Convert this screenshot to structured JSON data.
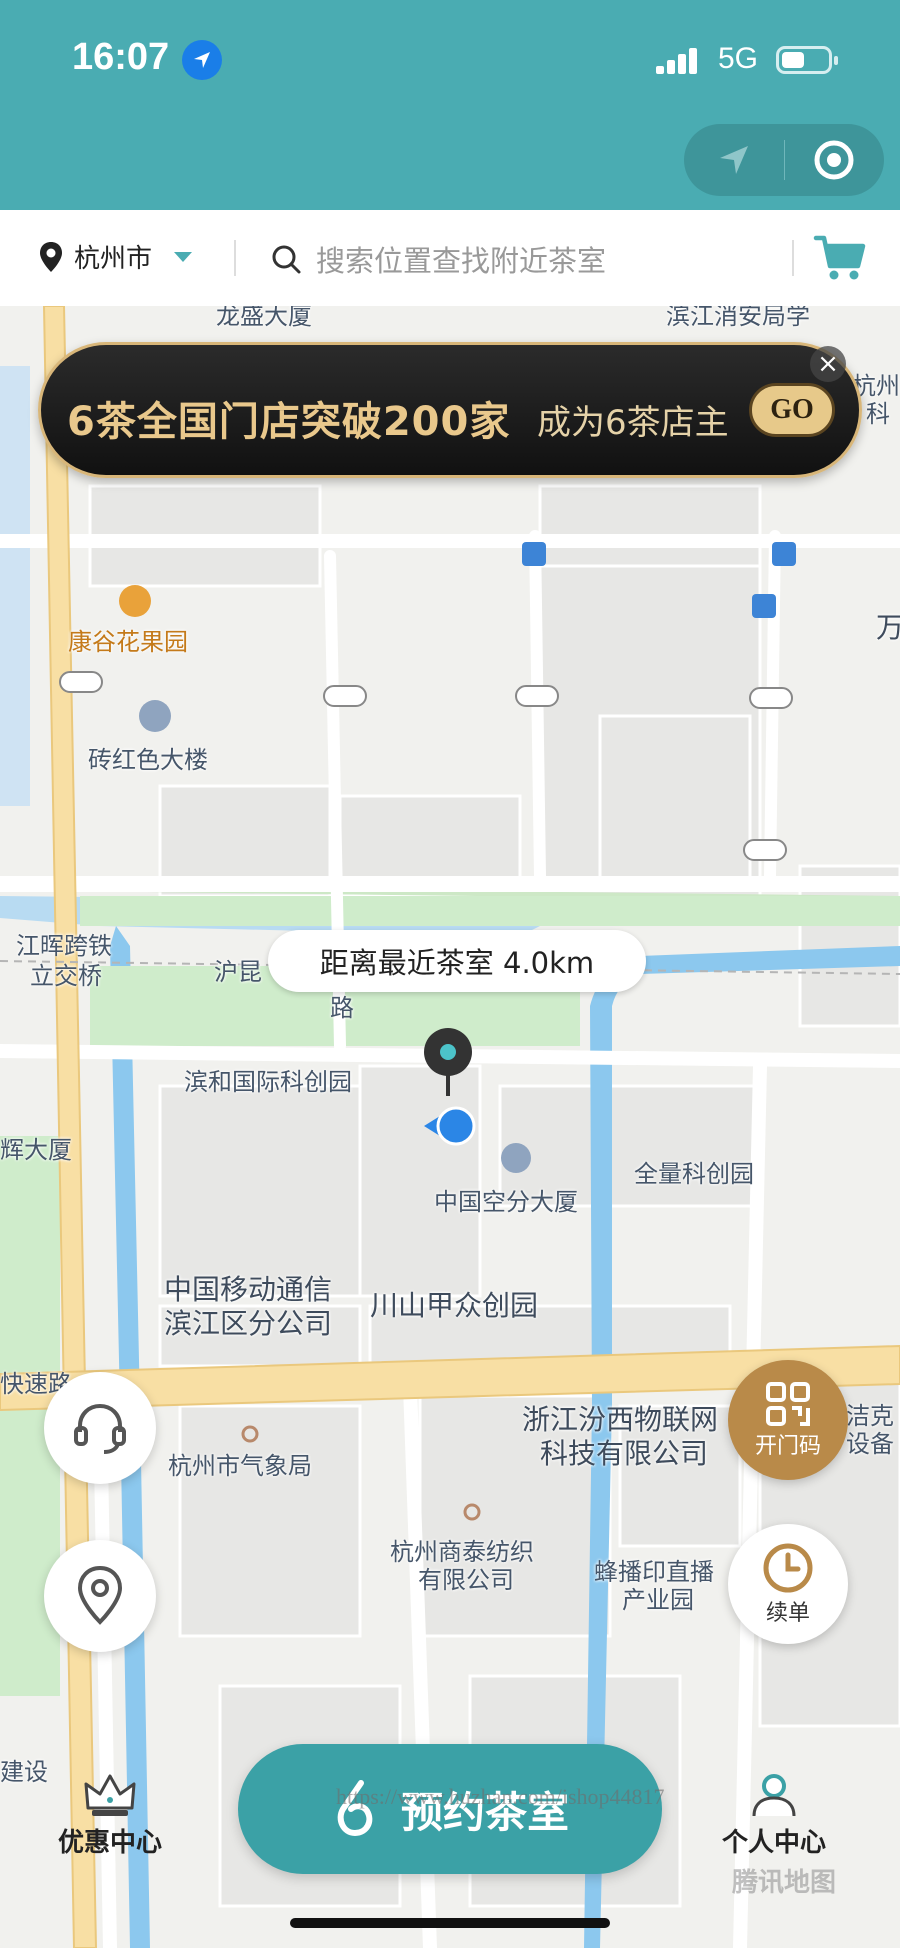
{
  "status": {
    "time": "16:07",
    "network": "5G"
  },
  "search_bar": {
    "city": "杭州市",
    "placeholder": "搜索位置查找附近茶室"
  },
  "banner": {
    "headline": "6茶全国门店突破200家",
    "subline": "成为6茶店主",
    "go_label": "GO"
  },
  "distance_bubble": "距离最近茶室 4.0km",
  "map_labels": {
    "l1": "康谷花果园",
    "l2": "砖红色大楼",
    "l3": "江晖跨铁",
    "l4": "立交桥",
    "l5": "沪昆",
    "l6": "路",
    "l7": "滨和国际科创园",
    "l8": "中国空分大厦",
    "l9": "全量科创园",
    "l10": "中国移动通信",
    "l11": "滨江区分公司",
    "l12": "川山甲众创园",
    "l13": "快速路",
    "l14": "杭州市气象局",
    "l15": "浙江汾西物联网",
    "l16": "科技有限公司",
    "l17": "杭州商泰纺织",
    "l18": "有限公司",
    "l19": "蜂播印直播",
    "l20": "产业园",
    "l21": "辉大厦",
    "l22": "洁克",
    "l23": "设备",
    "l24": "万",
    "l25": "杭州",
    "l26": "科",
    "l27": "建设",
    "l28": "滨江消安局学",
    "l29": "龙盛大厦"
  },
  "buttons": {
    "open_door": "开门码",
    "renew": "续单",
    "book": "预约茶室"
  },
  "bottom_nav": {
    "left": "优惠中心",
    "right": "个人中心"
  },
  "watermark": "https://www.huzhan.com/ishop44817",
  "map_attribution": "腾讯地图",
  "colors": {
    "primary": "#4aacb2",
    "button": "#3ba1a6",
    "gold": "#b98a49"
  }
}
